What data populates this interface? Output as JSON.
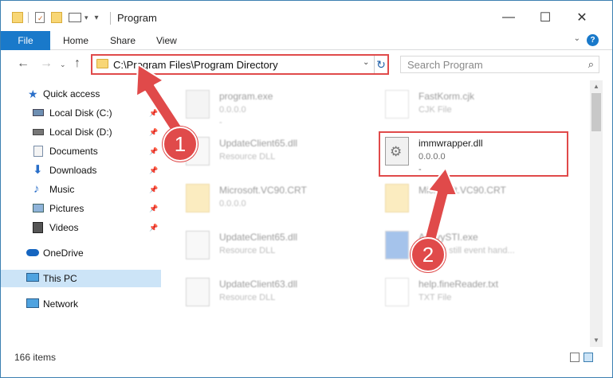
{
  "window": {
    "title": "Program",
    "minimize_glyph": "—",
    "maximize_glyph": "☐",
    "close_glyph": "✕"
  },
  "ribbon": {
    "tabs": [
      "File",
      "Home",
      "Share",
      "View"
    ],
    "help_glyph": "?"
  },
  "address": {
    "path": "C:\\Program Files\\Program Directory",
    "search_placeholder": "Search Program"
  },
  "nav": {
    "items": [
      {
        "label": "Quick access",
        "icon": "star-icon",
        "pinned": false
      },
      {
        "label": "Local Disk (C:)",
        "icon": "drive-icon",
        "pinned": true
      },
      {
        "label": "Local Disk (D:)",
        "icon": "drive-icon",
        "pinned": true
      },
      {
        "label": "Documents",
        "icon": "documents-icon",
        "pinned": true
      },
      {
        "label": "Downloads",
        "icon": "download-icon",
        "pinned": true
      },
      {
        "label": "Music",
        "icon": "music-icon",
        "pinned": true
      },
      {
        "label": "Pictures",
        "icon": "pictures-icon",
        "pinned": true
      },
      {
        "label": "Videos",
        "icon": "videos-icon",
        "pinned": true
      },
      {
        "label": "OneDrive",
        "icon": "cloud-icon",
        "pinned": false
      },
      {
        "label": "This PC",
        "icon": "computer-icon",
        "pinned": false,
        "selected": true
      },
      {
        "label": "Network",
        "icon": "network-icon",
        "pinned": false
      }
    ]
  },
  "files": [
    {
      "name": "program.exe",
      "sub": "0.0.0.0",
      "sub2": "-",
      "type": "exe",
      "blurred": true
    },
    {
      "name": "FastKorm.cjk",
      "sub": "CJK File",
      "sub2": "",
      "type": "doc",
      "blurred": true
    },
    {
      "name": "UpdateClient65.dll",
      "sub": "Resource DLL",
      "sub2": "",
      "type": "dll",
      "blurred": true
    },
    {
      "name": "immwrapper.dll",
      "sub": "0.0.0.0",
      "sub2": "-",
      "type": "dll",
      "blurred": false
    },
    {
      "name": "Microsoft.VC90.CRT",
      "sub": "0.0.0.0",
      "sub2": "",
      "type": "folder",
      "blurred": true
    },
    {
      "name": "Microsoft.VC90.CRT",
      "sub": "",
      "sub2": "",
      "type": "folder",
      "blurred": true
    },
    {
      "name": "UpdateClient65.dll",
      "sub": "Resource DLL",
      "sub2": "",
      "type": "dll",
      "blurred": true
    },
    {
      "name": "AbbyySTI.exe",
      "sub": "TWAIN still event hand...",
      "sub2": "",
      "type": "exe",
      "blurred": true
    },
    {
      "name": "UpdateClient63.dll",
      "sub": "Resource DLL",
      "sub2": "",
      "type": "dll",
      "blurred": true
    },
    {
      "name": "help.fineReader.txt",
      "sub": "TXT File",
      "sub2": "",
      "type": "doc",
      "blurred": true
    }
  ],
  "status": {
    "item_count": "166 items"
  },
  "annotations": {
    "badge1": "1",
    "badge2": "2",
    "color": "#e04a4a"
  }
}
